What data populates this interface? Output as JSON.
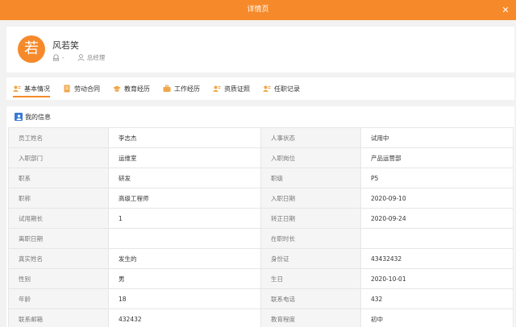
{
  "window": {
    "title": "详情页"
  },
  "profile": {
    "avatar_char": "若",
    "name": "风若笑",
    "meta_value": "-",
    "position": "总经理"
  },
  "tabs": [
    {
      "label": "基本情况",
      "icon": "user-card-icon",
      "active": true
    },
    {
      "label": "劳动合同",
      "icon": "contract-icon",
      "active": false
    },
    {
      "label": "教育经历",
      "icon": "graduation-cap-icon",
      "active": false
    },
    {
      "label": "工作经历",
      "icon": "briefcase-icon",
      "active": false
    },
    {
      "label": "资质证照",
      "icon": "certificate-icon",
      "active": false
    },
    {
      "label": "任职记录",
      "icon": "record-icon",
      "active": false
    }
  ],
  "section": {
    "title": "我的信息"
  },
  "rows": [
    [
      "员工姓名",
      "李志杰",
      "人事状态",
      "试用中"
    ],
    [
      "入职部门",
      "运维室",
      "入职岗位",
      "产品运营部"
    ],
    [
      "职系",
      "研发",
      "职级",
      "P5"
    ],
    [
      "职称",
      "高级工程师",
      "入职日期",
      "2020-09-10"
    ],
    [
      "试用期长",
      "1",
      "转正日期",
      "2020-09-24"
    ],
    [
      "离职日期",
      "",
      "在职时长",
      ""
    ],
    [
      "真实姓名",
      "发生的",
      "身份证",
      "43432432"
    ],
    [
      "性别",
      "男",
      "生日",
      "2020-10-01"
    ],
    [
      "年龄",
      "18",
      "联系电话",
      "432"
    ],
    [
      "联系邮箱",
      "432432",
      "教育程度",
      "初中"
    ]
  ],
  "colors": {
    "accent": "#f68a2a",
    "badge": "#3a7bd5"
  }
}
